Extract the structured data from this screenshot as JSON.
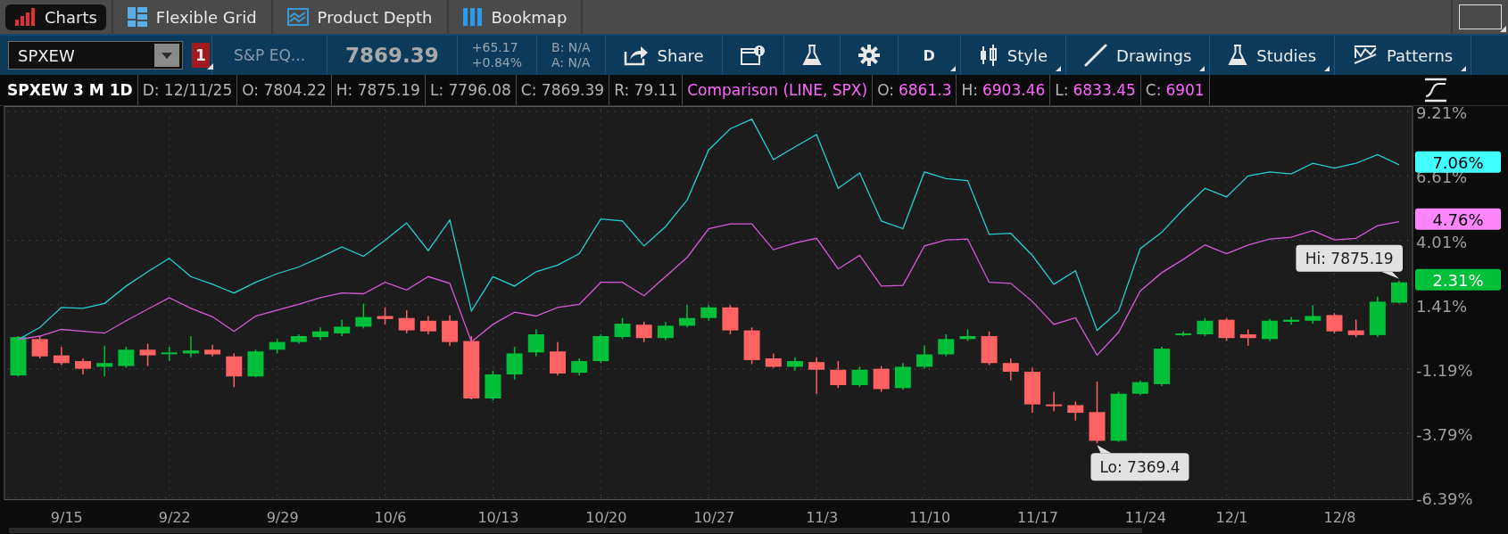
{
  "top_tabs": [
    {
      "label": "Charts",
      "selected": true,
      "kind": "bars"
    },
    {
      "label": "Flexible Grid",
      "selected": false,
      "kind": "grid"
    },
    {
      "label": "Product Depth",
      "selected": false,
      "kind": "depth"
    },
    {
      "label": "Bookmap",
      "selected": false,
      "kind": "columns"
    }
  ],
  "toolbar": {
    "symbol": "SPXEW",
    "alert_count": "1",
    "description": "S&P EQ...",
    "last": "7869.39",
    "change": "+65.17",
    "change_pct": "+0.84%",
    "bid": "B: N/A",
    "ask": "A: N/A",
    "buttons": [
      {
        "kind": "share",
        "label": "Share",
        "menu": false
      },
      {
        "kind": "info",
        "menu": false
      },
      {
        "kind": "flask",
        "menu": false
      },
      {
        "kind": "gear",
        "menu": false
      },
      {
        "kind": "text",
        "label": "D",
        "menu": true
      },
      {
        "kind": "style",
        "label": "Style",
        "menu": true
      },
      {
        "kind": "drawings",
        "label": "Drawings",
        "menu": true
      },
      {
        "kind": "flask",
        "label": "Studies",
        "menu": true
      },
      {
        "kind": "patterns",
        "label": "Patterns",
        "menu": true
      }
    ]
  },
  "info_bar": {
    "title": "SPXEW 3 M 1D",
    "fields": [
      {
        "label": "D:",
        "value": "12/11/25"
      },
      {
        "label": "O:",
        "value": "7804.22"
      },
      {
        "label": "H:",
        "value": "7875.19"
      },
      {
        "label": "L:",
        "value": "7796.08"
      },
      {
        "label": "C:",
        "value": "7869.39"
      },
      {
        "label": "R:",
        "value": "79.11"
      }
    ],
    "comparison": {
      "title": "Comparison (LINE, SPX)",
      "fields": [
        {
          "label": "O:",
          "value": "6861.3"
        },
        {
          "label": "H:",
          "value": "6903.46"
        },
        {
          "label": "L:",
          "value": "6833.45"
        },
        {
          "label": "C:",
          "value": "6901"
        }
      ]
    }
  },
  "chart": {
    "chart_data": {
      "type": "line",
      "grid": true,
      "ylim": [
        -6.45,
        9.43
      ],
      "categories": [
        null,
        null,
        "9/15",
        null,
        null,
        null,
        null,
        "9/22",
        null,
        null,
        null,
        null,
        "9/29",
        null,
        null,
        null,
        null,
        "10/6",
        null,
        null,
        null,
        null,
        "10/13",
        null,
        null,
        null,
        null,
        "10/20",
        null,
        null,
        null,
        null,
        "10/27",
        null,
        null,
        null,
        null,
        "11/3",
        null,
        null,
        null,
        null,
        "11/10",
        null,
        null,
        null,
        null,
        "11/17",
        null,
        null,
        null,
        null,
        "11/24",
        null,
        null,
        null,
        "12/1",
        null,
        null,
        null,
        null,
        "12/8",
        null,
        null,
        null
      ],
      "yticks": [
        {
          "value": 9.21,
          "label": "9.21%"
        },
        {
          "value": 6.61,
          "label": "6.61%"
        },
        {
          "value": 4.01,
          "label": "4.01%"
        },
        {
          "value": 1.41,
          "label": "1.41%"
        },
        {
          "value": -1.19,
          "label": "-1.19%"
        },
        {
          "value": -3.79,
          "label": "-3.79%"
        },
        {
          "value": -6.39,
          "label": "-6.39%"
        }
      ],
      "series": [
        {
          "color": "#25cfcf",
          "values": [
            0.0,
            0.49,
            1.3,
            1.26,
            1.46,
            2.16,
            2.74,
            3.28,
            2.54,
            2.23,
            1.88,
            2.31,
            2.66,
            2.93,
            3.32,
            3.74,
            3.36,
            4.01,
            4.71,
            3.59,
            4.83,
            1.15,
            2.54,
            2.16,
            2.74,
            3.01,
            3.47,
            4.87,
            4.79,
            3.78,
            4.56,
            5.64,
            7.66,
            8.51,
            8.9,
            7.27,
            7.78,
            8.28,
            6.11,
            6.73,
            4.79,
            4.48,
            6.77,
            6.5,
            6.42,
            4.25,
            4.29,
            3.4,
            2.23,
            2.78,
            0.37,
            1.15,
            3.67,
            4.33,
            5.26,
            6.11,
            5.76,
            6.61,
            6.77,
            6.69,
            7.12,
            6.92,
            7.12,
            7.47,
            7.06
          ]
        },
        {
          "color": "#d65ad6",
          "values": [
            0.0,
            0.14,
            0.41,
            0.33,
            0.26,
            0.76,
            1.23,
            1.69,
            1.26,
            0.92,
            0.33,
            0.95,
            1.19,
            1.42,
            1.69,
            1.88,
            1.85,
            2.31,
            2.0,
            2.54,
            2.27,
            -0.09,
            0.61,
            1.11,
            0.95,
            1.3,
            1.42,
            2.31,
            2.31,
            1.77,
            2.54,
            3.32,
            4.48,
            4.67,
            4.67,
            3.63,
            3.9,
            4.09,
            2.85,
            3.4,
            2.16,
            2.19,
            3.78,
            4.02,
            4.06,
            2.31,
            2.27,
            1.54,
            0.61,
            0.88,
            -0.63,
            0.3,
            1.96,
            2.7,
            3.24,
            3.82,
            3.47,
            3.82,
            4.06,
            4.13,
            4.4,
            4.02,
            4.09,
            4.6,
            4.76
          ]
        }
      ],
      "annotations": [
        "7.06%",
        "4.76%",
        "2.31%",
        "Hi: 7875.19",
        "Lo: 7369.4"
      ]
    }
  }
}
